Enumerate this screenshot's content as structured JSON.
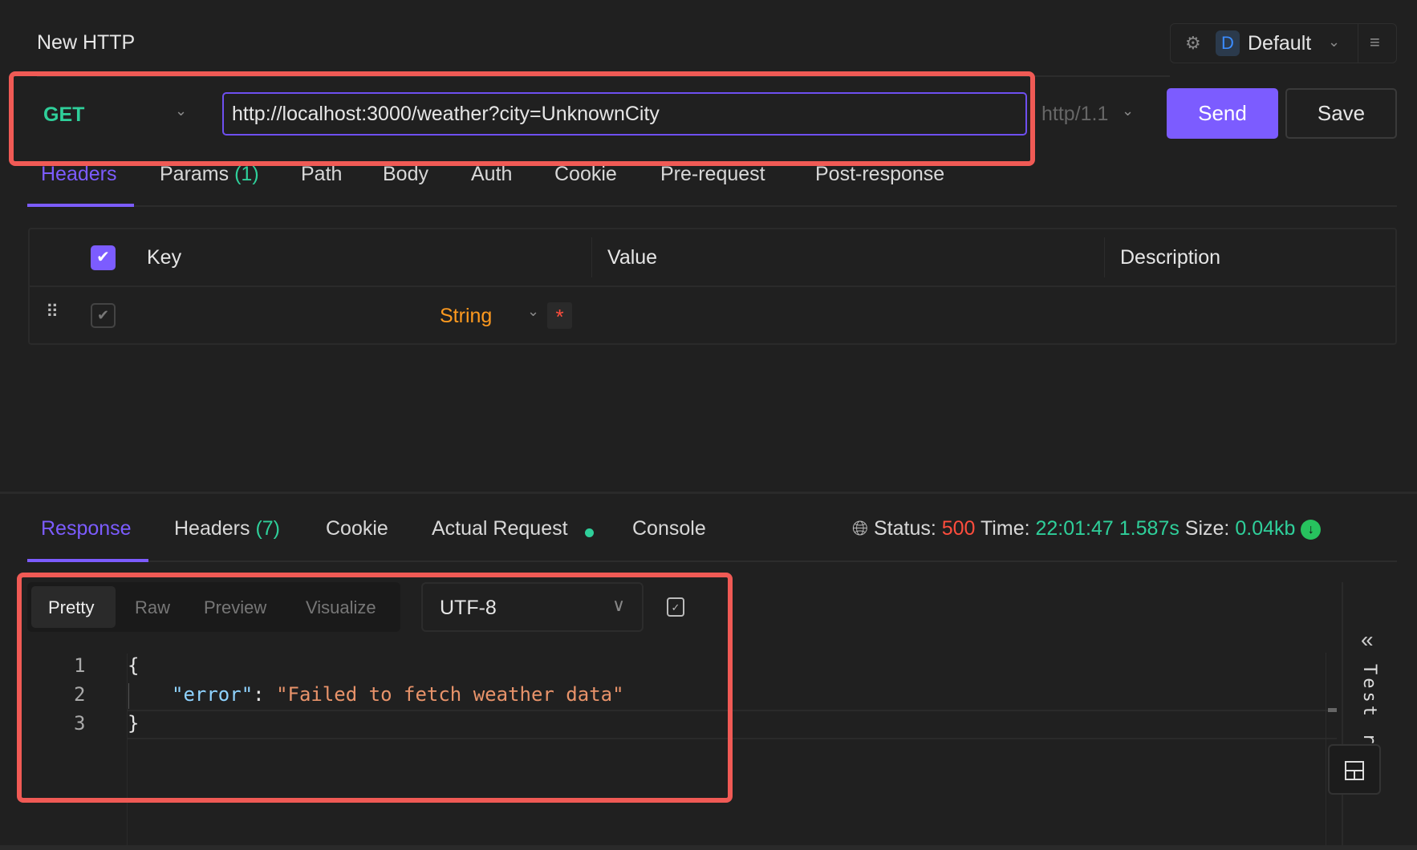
{
  "header": {
    "title": "New HTTP",
    "env_avatar": "D",
    "env_name": "Default"
  },
  "request": {
    "method": "GET",
    "url": "http://localhost:3000/weather?city=UnknownCity",
    "protocol": "http/1.1",
    "send_label": "Send",
    "save_label": "Save"
  },
  "request_tabs": [
    {
      "label": "Headers",
      "active": true
    },
    {
      "label": "Params",
      "count": "(1)"
    },
    {
      "label": "Path"
    },
    {
      "label": "Body"
    },
    {
      "label": "Auth"
    },
    {
      "label": "Cookie"
    },
    {
      "label": "Pre-request"
    },
    {
      "label": "Post-response"
    }
  ],
  "headers_table": {
    "columns": [
      "Key",
      "Value",
      "Description"
    ],
    "rows": [
      {
        "enabled": true,
        "key": "",
        "type": "String",
        "required_mark": "*",
        "value": "",
        "description": ""
      }
    ]
  },
  "response_tabs": [
    {
      "label": "Response",
      "active": true
    },
    {
      "label": "Headers",
      "count": "(7)"
    },
    {
      "label": "Cookie"
    },
    {
      "label": "Actual Request"
    },
    {
      "label": "Console"
    }
  ],
  "status": {
    "status_label": "Status:",
    "status_value": "500",
    "time_label": "Time:",
    "time_value": "22:01:47",
    "duration": "1.587s",
    "size_label": "Size:",
    "size_value": "0.04kb"
  },
  "viewer": {
    "modes": [
      "Pretty",
      "Raw",
      "Preview",
      "Visualize"
    ],
    "active_mode": "Pretty",
    "encoding": "UTF-8"
  },
  "code": {
    "lines": [
      {
        "num": "1",
        "text": "{"
      },
      {
        "num": "2",
        "key": "\"error\"",
        "sep": ": ",
        "value": "\"Failed to fetch weather data\""
      },
      {
        "num": "3",
        "text": "}"
      }
    ]
  },
  "side_panel": {
    "label": "Test re..."
  },
  "colors": {
    "accent": "#7c5cff",
    "get": "#2fcf9a",
    "error": "#ff4d3d",
    "highlight": "#f05a55",
    "string_type": "#ff9a1f"
  }
}
